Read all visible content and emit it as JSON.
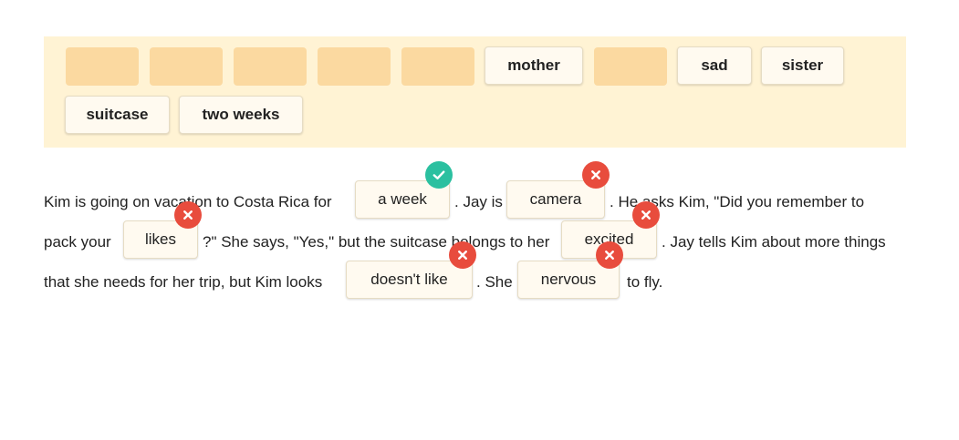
{
  "word_bank": {
    "chips": [
      "mother",
      "sad",
      "sister",
      "suitcase",
      "two weeks"
    ]
  },
  "passage": {
    "line1": {
      "t1": "Kim is going on vacation to Costa Rica for",
      "a1": "a week",
      "t2": ". Jay is",
      "a2": "camera",
      "t3": ". He asks Kim, \"Did you remember to"
    },
    "line2": {
      "t1": "pack your",
      "a1": "likes",
      "t2": "?\" She says, \"Yes,\" but the suitcase belongs to her",
      "a2": "excited",
      "t3": ". Jay tells Kim about more things"
    },
    "line3": {
      "t1": "that she needs for her trip, but Kim looks",
      "a1": "doesn't like",
      "t2": ". She",
      "a2": "nervous",
      "t3": "to fly."
    }
  },
  "results": {
    "a_week": "correct",
    "camera": "incorrect",
    "likes": "incorrect",
    "excited": "incorrect",
    "doesnt_like": "incorrect",
    "nervous": "incorrect"
  },
  "icons": {
    "correct": "check-icon",
    "incorrect": "x-icon"
  },
  "colors": {
    "bank_background": "#fff3d4",
    "empty_slot": "#fbd9a0",
    "correct": "#2bc0a0",
    "incorrect": "#e84c3d"
  }
}
